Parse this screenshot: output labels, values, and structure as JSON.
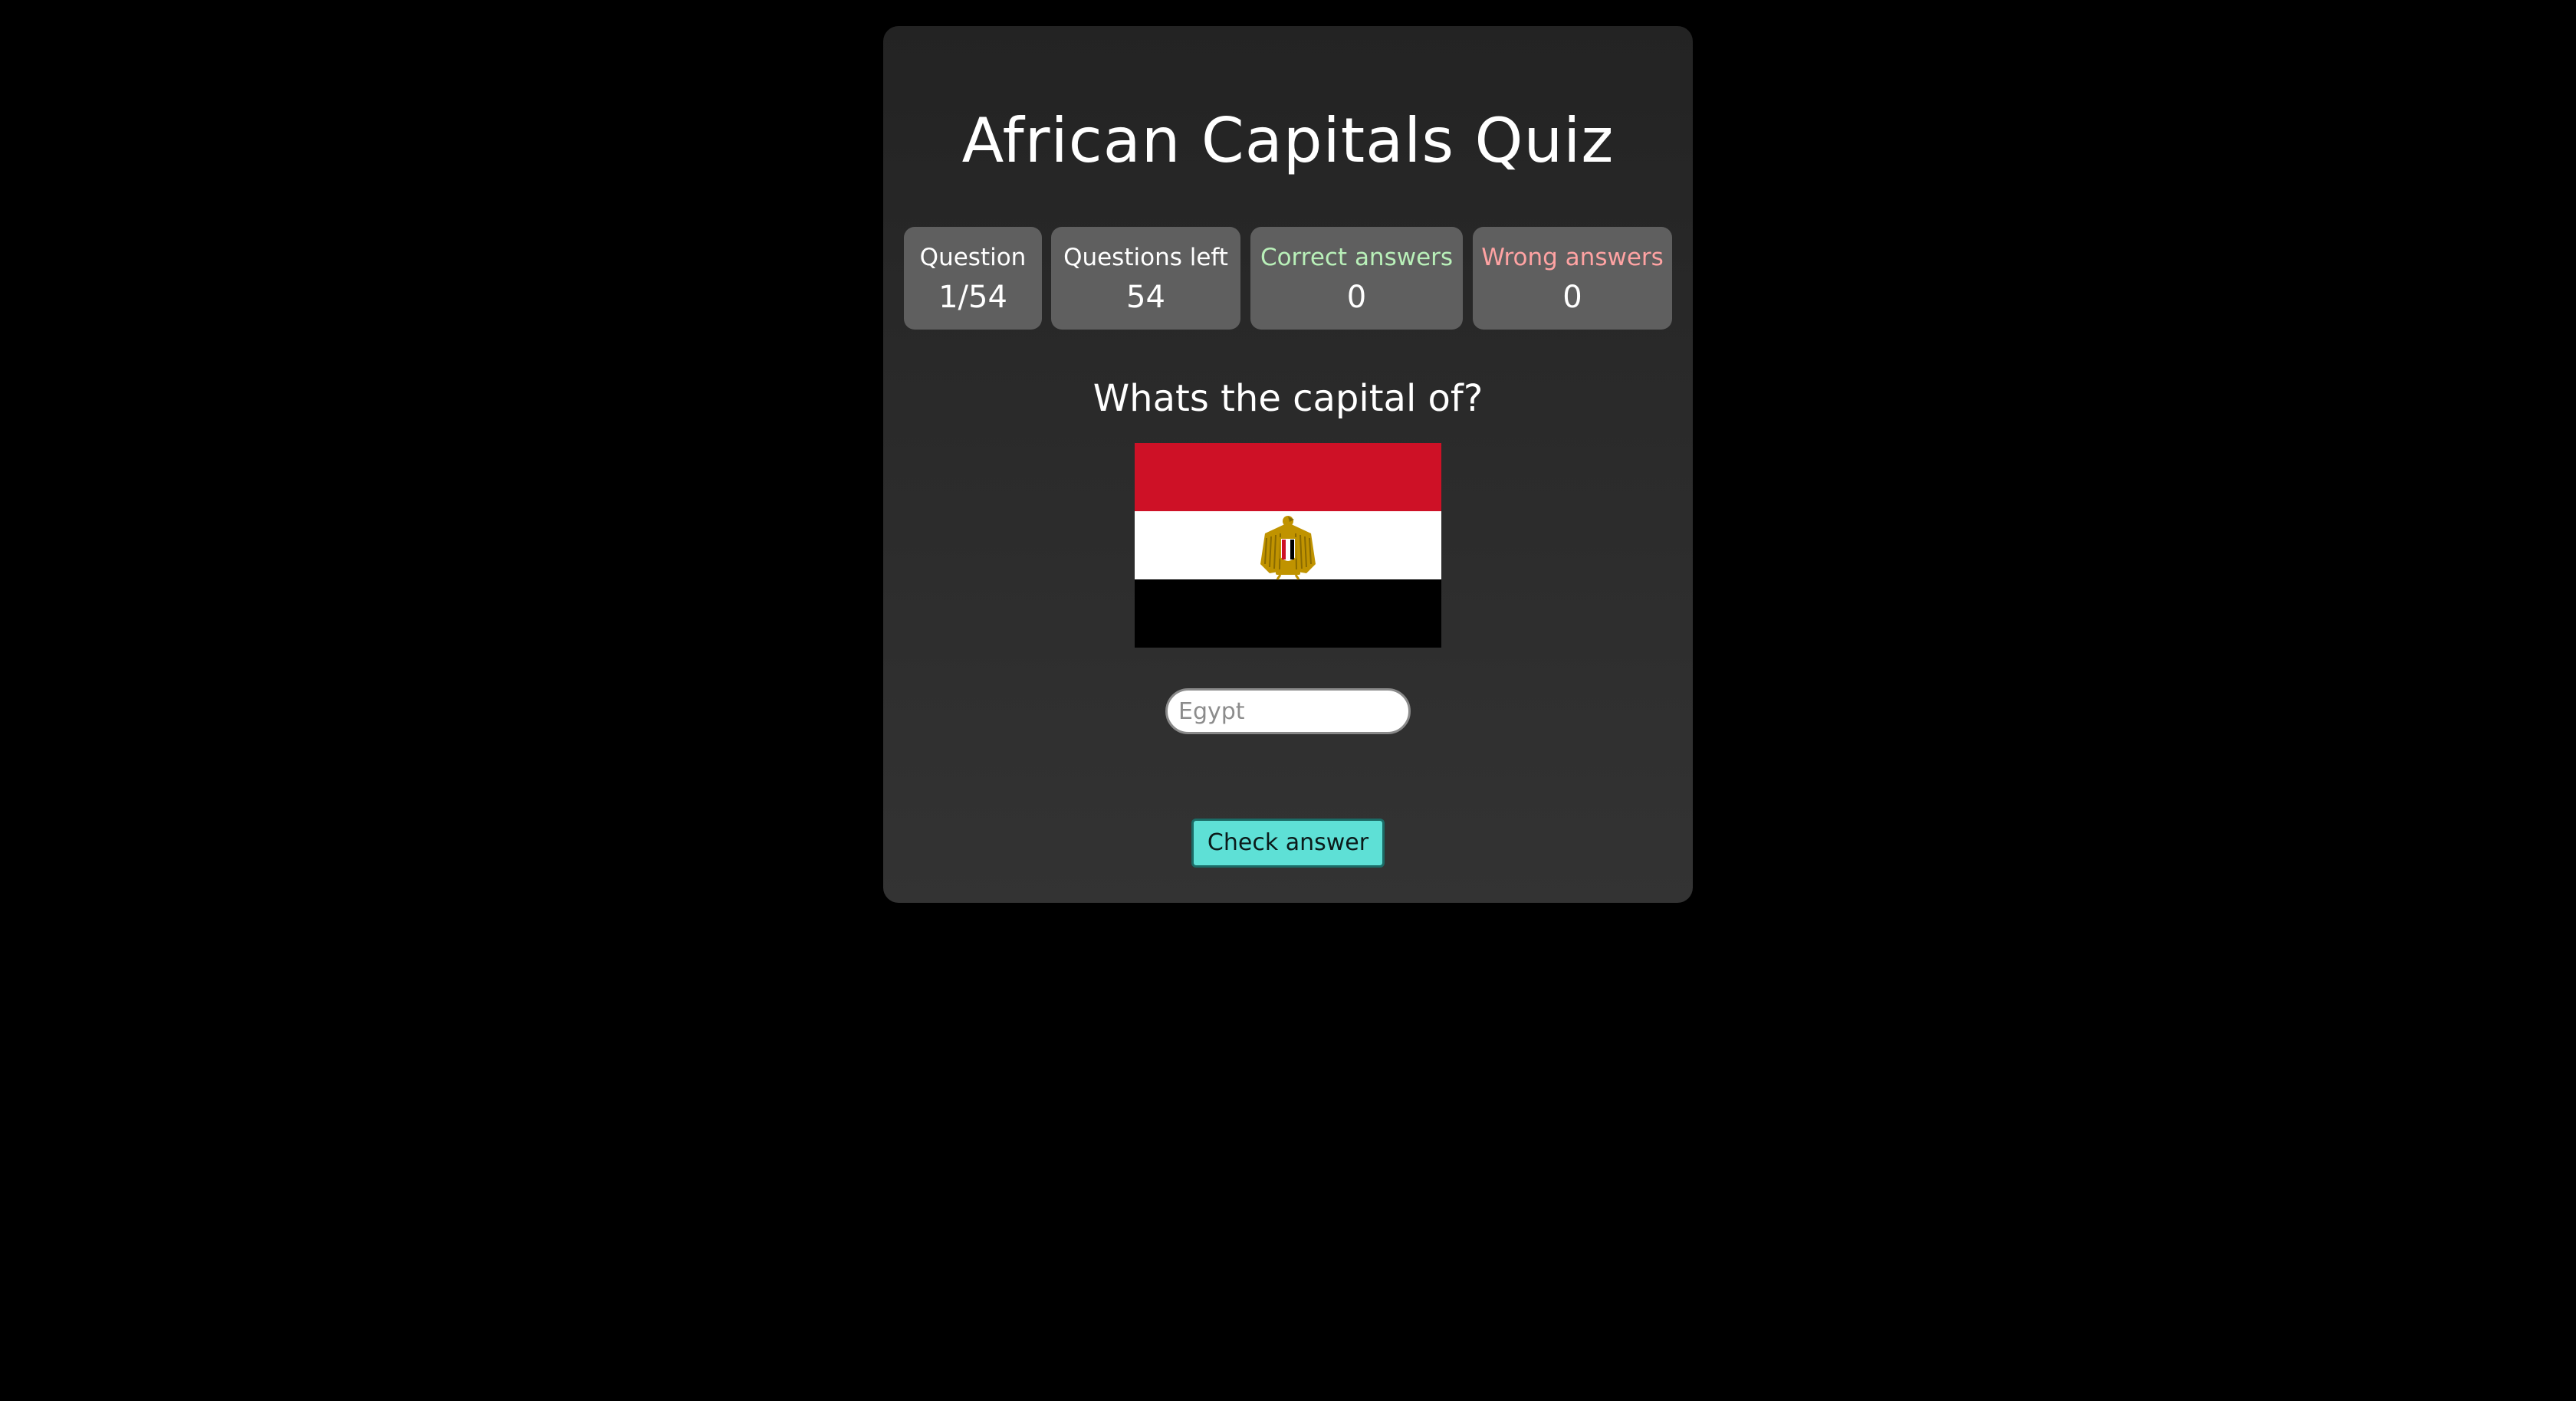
{
  "quiz": {
    "title": "African Capitals Quiz",
    "question_prompt": "Whats the capital of?"
  },
  "stats": {
    "question": {
      "label": "Question",
      "value": "1/54"
    },
    "questions_left": {
      "label": "Questions left",
      "value": "54"
    },
    "correct_answers": {
      "label": "Correct answers",
      "value": "0"
    },
    "wrong_answers": {
      "label": "Wrong answers",
      "value": "0"
    }
  },
  "flag": {
    "country": "Egypt",
    "colors": {
      "top": "#CE1126",
      "middle": "#FFFFFF",
      "bottom": "#000000",
      "emblem": "#C09300"
    }
  },
  "answer": {
    "placeholder": "Egypt",
    "value": ""
  },
  "buttons": {
    "check_label": "Check answer"
  },
  "theme": {
    "page_bg": "#000000",
    "card_bg": "#2a2a2a",
    "stat_bg": "#5f5f5f",
    "correct_color": "#b9f0b9",
    "wrong_color": "#ffa3a3",
    "accent": "#5ee0d6"
  }
}
